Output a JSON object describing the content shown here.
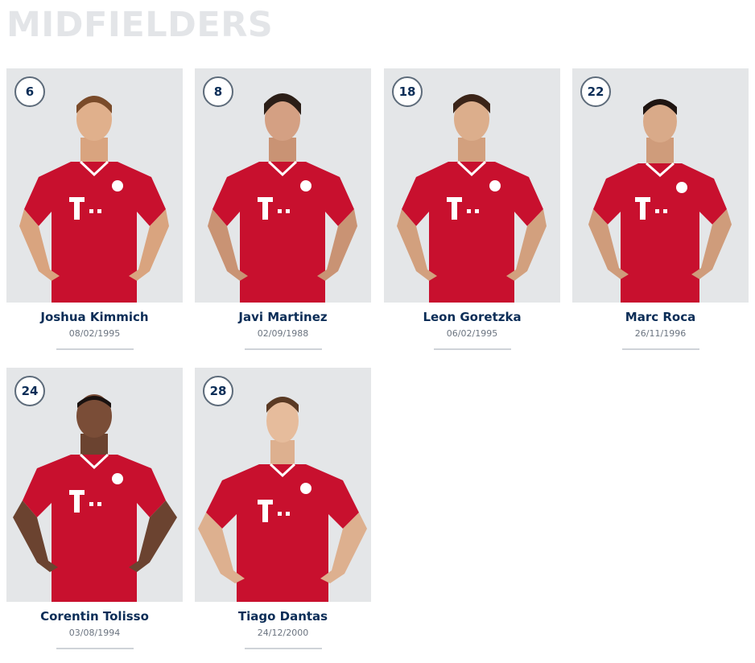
{
  "section": {
    "title": "MIDFIELDERS"
  },
  "players": [
    {
      "number": "6",
      "name": "Joshua Kimmich",
      "dob": "08/02/1995"
    },
    {
      "number": "8",
      "name": "Javi Martinez",
      "dob": "02/09/1988"
    },
    {
      "number": "18",
      "name": "Leon Goretzka",
      "dob": "06/02/1995"
    },
    {
      "number": "22",
      "name": "Marc Roca",
      "dob": "26/11/1996"
    },
    {
      "number": "24",
      "name": "Corentin Tolisso",
      "dob": "03/08/1994"
    },
    {
      "number": "28",
      "name": "Tiago Dantas",
      "dob": "24/12/2000"
    }
  ],
  "colors": {
    "jersey": "#c8102e",
    "jersey_dark": "#9e0c24",
    "card_bg": "#e4e6e8",
    "name_text": "#0b2d57",
    "title_text": "#e3e5e8"
  },
  "icons": {
    "figure": "player-photo-figure"
  }
}
